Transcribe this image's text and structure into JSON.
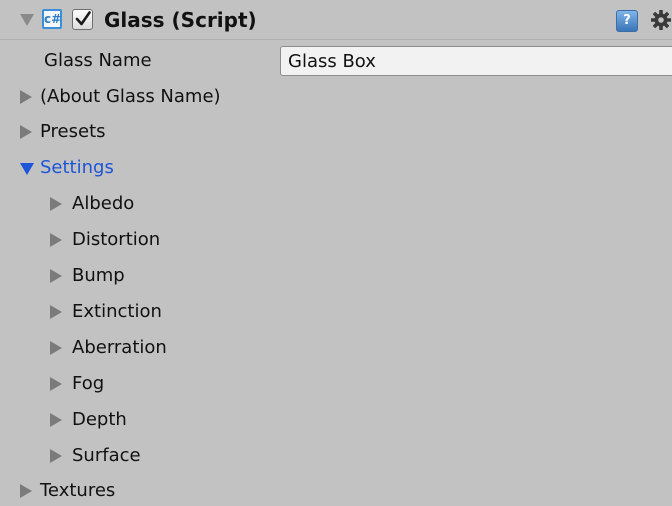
{
  "component": {
    "title": "Glass (Script)",
    "enabled": true,
    "script_icon_glyph": "c#",
    "help_glyph": "?",
    "icons": {
      "fold": "chevron-down-icon",
      "script": "csharp-script-icon",
      "enabled": "checkbox-checked",
      "help": "help-book-icon",
      "settings": "gear-icon"
    }
  },
  "fields": {
    "glass_name": {
      "label": "Glass Name",
      "value": "Glass Box"
    }
  },
  "foldouts": [
    {
      "label": "(About Glass Name)",
      "expanded": false
    },
    {
      "label": "Presets",
      "expanded": false
    },
    {
      "label": "Settings",
      "expanded": true
    }
  ],
  "settings_children": [
    {
      "label": "Albedo"
    },
    {
      "label": "Distortion"
    },
    {
      "label": "Bump"
    },
    {
      "label": "Extinction"
    },
    {
      "label": "Aberration"
    },
    {
      "label": "Fog"
    },
    {
      "label": "Depth"
    },
    {
      "label": "Surface"
    }
  ],
  "trailing_foldouts": [
    {
      "label": "Textures",
      "expanded": false
    }
  ],
  "colors": {
    "panel_bg": "#c2c2c2",
    "expanded_text": "#1d55d8",
    "triangle": "#7b7b7b"
  }
}
